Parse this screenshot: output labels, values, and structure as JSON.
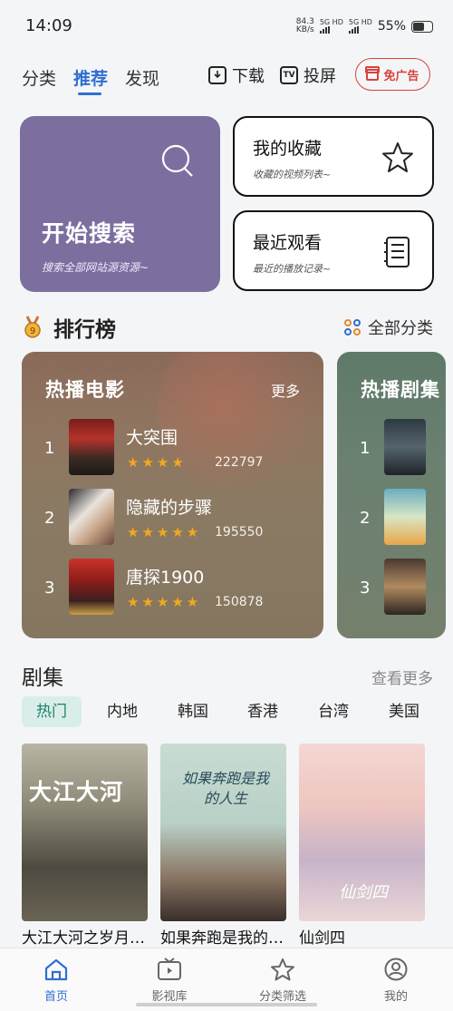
{
  "status": {
    "time": "14:09",
    "net_speed": "84.3",
    "net_unit": "KB/s",
    "sig1": "5G HD",
    "sig2": "5G HD",
    "battery_pct": "55%",
    "battery_level": 0.55
  },
  "topnav": {
    "tabs": [
      {
        "label": "分类"
      },
      {
        "label": "推荐"
      },
      {
        "label": "发现"
      }
    ],
    "download_label": "下载",
    "cast_label": "投屏",
    "cast_icon_text": "TV",
    "noad_label": "免广告"
  },
  "quick": {
    "search_title": "开始搜索",
    "search_sub": "搜索全部网站源资源~",
    "fav_title": "我的收藏",
    "fav_sub": "收藏的视频列表~",
    "recent_title": "最近观看",
    "recent_sub": "最近的播放记录~"
  },
  "ranking": {
    "title": "排行榜",
    "all_label": "全部分类",
    "medal_text": "9",
    "movie": {
      "title": "热播电影",
      "more": "更多",
      "items": [
        {
          "rank": "1",
          "name": "大突围",
          "stars": "★★★★",
          "rating": 4,
          "score": "222797"
        },
        {
          "rank": "2",
          "name": "隐藏的步骤",
          "stars": "★★★★★",
          "rating": 5,
          "score": "195550"
        },
        {
          "rank": "3",
          "name": "唐探1900",
          "stars": "★★★★★",
          "rating": 5,
          "score": "150878"
        }
      ]
    },
    "drama": {
      "title": "热播剧集",
      "items": [
        {
          "rank": "1"
        },
        {
          "rank": "2"
        },
        {
          "rank": "3"
        }
      ]
    }
  },
  "series": {
    "title": "剧集",
    "more": "查看更多",
    "regions": [
      "热门",
      "内地",
      "韩国",
      "香港",
      "台湾",
      "美国"
    ],
    "cards": [
      {
        "title": "大江大河之岁月如歌",
        "poster_text": "大江大河"
      },
      {
        "title": "如果奔跑是我的人生",
        "poster_text": "如果奔跑是我的人生"
      },
      {
        "title": "仙剑四",
        "poster_text": "仙剑四"
      }
    ]
  },
  "bottomnav": [
    {
      "label": "首页"
    },
    {
      "label": "影视库"
    },
    {
      "label": "分类筛选"
    },
    {
      "label": "我的"
    }
  ]
}
